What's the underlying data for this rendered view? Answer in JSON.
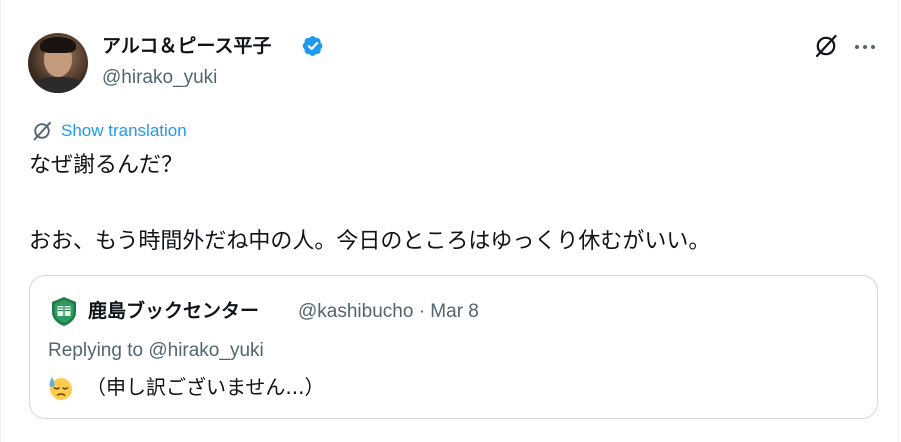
{
  "tweet": {
    "author": {
      "display_name": "アルコ＆ピース平子",
      "handle": "@hirako_yuki",
      "verified": true,
      "avatar_icon": "profile-photo"
    },
    "actions": {
      "grok_icon": "grok-icon",
      "more_icon": "more-icon"
    },
    "translate_label": "Show translation",
    "text_lines": [
      "なぜ謝るんだ？",
      "おお、もう時間外だね中の人。今日のところはゆっくり休むがいい。"
    ],
    "quote": {
      "display_name": "鹿島ブックセンター",
      "handle_and_date": "@kashibucho · Mar 8",
      "replying_to": "Replying to @hirako_yuki",
      "emoji_icon": "downcast-face-with-sweat-icon",
      "text": "（申し訳ございません...）"
    }
  },
  "colors": {
    "text": "#0f1419",
    "secondary": "#536471",
    "link": "#1d9bf0",
    "border": "#cfd9de",
    "verified": "#1d9bf0"
  }
}
